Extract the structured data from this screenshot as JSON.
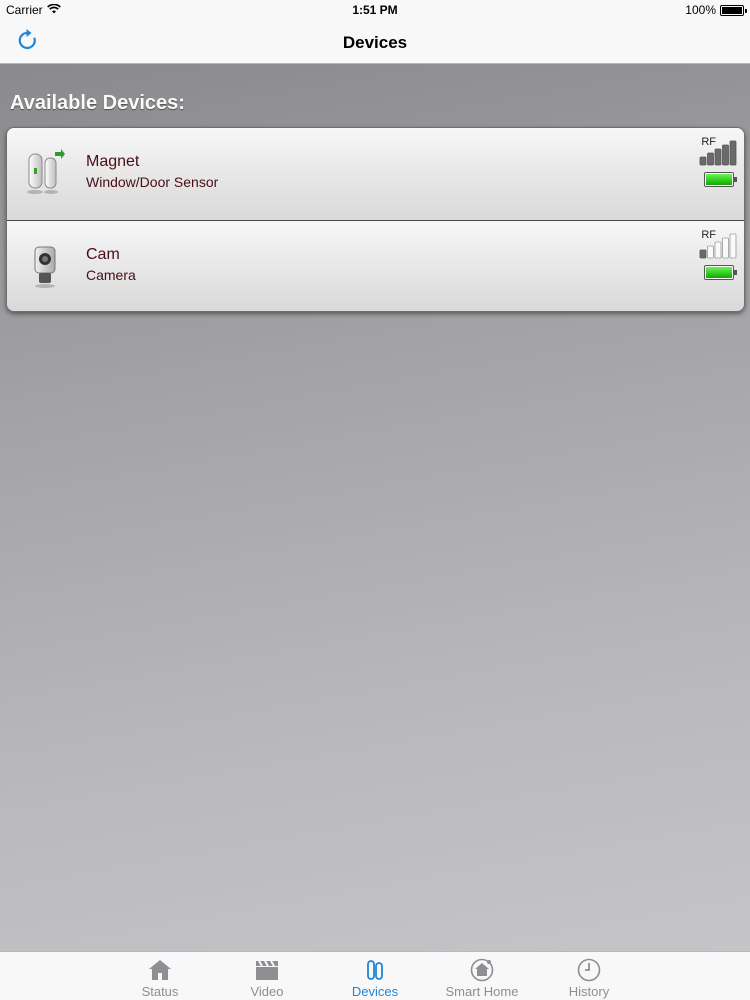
{
  "status_bar": {
    "carrier": "Carrier",
    "time": "1:51 PM",
    "battery": "100%",
    "battery_level": 1.0
  },
  "nav": {
    "title": "Devices",
    "refresh_icon": "refresh-icon"
  },
  "content": {
    "section_title": "Available Devices:",
    "devices": [
      {
        "name": "Magnet",
        "type": "Window/Door Sensor",
        "icon": "door-sensor-icon",
        "rf_label": "RF",
        "signal_bars": 5,
        "battery_level": 1.0
      },
      {
        "name": "Cam",
        "type": "Camera",
        "icon": "camera-icon",
        "rf_label": "RF",
        "signal_bars": 1,
        "battery_level": 1.0
      }
    ]
  },
  "tabs": [
    {
      "label": "Status",
      "icon": "house-icon",
      "active": false
    },
    {
      "label": "Video",
      "icon": "clapperboard-icon",
      "active": false
    },
    {
      "label": "Devices",
      "icon": "sensor-icon",
      "active": true
    },
    {
      "label": "Smart Home",
      "icon": "smart-home-icon",
      "active": false
    },
    {
      "label": "History",
      "icon": "clock-icon",
      "active": false
    }
  ],
  "colors": {
    "accent": "#1f86d9",
    "device_text": "#4a0d16",
    "battery_green": "#2bcc1a"
  }
}
